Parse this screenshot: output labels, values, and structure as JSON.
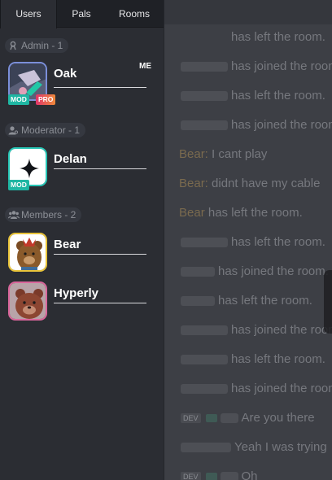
{
  "tabs": [
    {
      "label": "Users",
      "active": true
    },
    {
      "label": "Pals",
      "active": false
    },
    {
      "label": "Rooms",
      "active": false
    }
  ],
  "sections": {
    "admin": {
      "header": "Admin - 1",
      "icon": "admin-person-icon"
    },
    "moderator": {
      "header": "Moderator - 1",
      "icon": "moderator-person-icon"
    },
    "members": {
      "header": "Members - 2",
      "icon": "members-group-icon"
    }
  },
  "users": {
    "oak": {
      "name": "Oak",
      "me_label": "ME",
      "badges": [
        "MOD",
        "PRO"
      ],
      "avatar_border": "#7b8fd9"
    },
    "delan": {
      "name": "Delan",
      "badges": [
        "MOD"
      ],
      "avatar_border": "#27c6b6"
    },
    "bear": {
      "name": "Bear",
      "badges": [],
      "avatar_border": "#e9c43a"
    },
    "hyperly": {
      "name": "Hyperly",
      "badges": [],
      "avatar_border": "#d9669b"
    }
  },
  "chat": {
    "lines": [
      {
        "text": "has left the room."
      },
      {
        "text": "has joined the room."
      },
      {
        "text": "has left the room."
      },
      {
        "text": "has joined the room."
      },
      {
        "name": "Bear:",
        "text": "I cant play"
      },
      {
        "name": "Bear:",
        "text": "didnt have my cable"
      },
      {
        "name": "Bear",
        "text": "has left the room."
      },
      {
        "text": "has left the room."
      },
      {
        "text": "has joined the room."
      },
      {
        "text": "has left the room."
      },
      {
        "text": "has joined the room."
      },
      {
        "text": "has left the room."
      },
      {
        "text": "has joined the room."
      },
      {
        "badge": "DEV",
        "text": "Are you there"
      },
      {
        "text": "Yeah I was trying"
      },
      {
        "badge": "DEV",
        "text": "Oh"
      }
    ]
  },
  "colors": {
    "mod_badge": "#1fb6a3",
    "sidebar_bg": "#2b2d33",
    "tab_bar_bg": "#1f2126"
  }
}
